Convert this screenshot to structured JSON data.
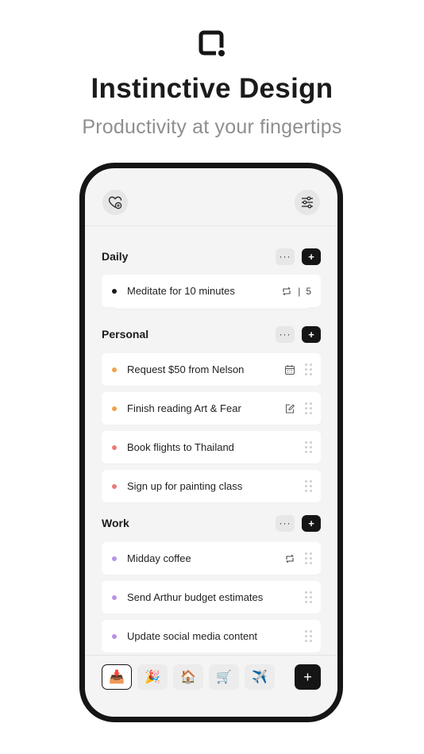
{
  "promo": {
    "title": "Instinctive Design",
    "subtitle": "Productivity at your fingertips"
  },
  "topbar": {
    "left_icon": "heart-plus-icon",
    "right_icon": "sliders-icon"
  },
  "sections": [
    {
      "title": "Daily",
      "more_label": "···",
      "add_label": "+",
      "tasks": [
        {
          "text": "Meditate for 10 minutes",
          "dot_color": "#1a1a1a",
          "icon": "repeat-icon",
          "separator": "|",
          "count": "5"
        }
      ]
    },
    {
      "title": "Personal",
      "more_label": "···",
      "add_label": "+",
      "tasks": [
        {
          "text": "Request $50 from Nelson",
          "dot_color": "#f0a24a",
          "icon": "calendar-icon"
        },
        {
          "text": "Finish reading Art & Fear",
          "dot_color": "#f0a24a",
          "icon": "note-edit-icon"
        },
        {
          "text": "Book flights to Thailand",
          "dot_color": "#ee7a7a",
          "icon": ""
        },
        {
          "text": "Sign up for painting class",
          "dot_color": "#ee7a7a",
          "icon": ""
        }
      ]
    },
    {
      "title": "Work",
      "more_label": "···",
      "add_label": "+",
      "tasks": [
        {
          "text": "Midday coffee",
          "dot_color": "#b892e6",
          "icon": "repeat-icon"
        },
        {
          "text": "Send Arthur budget estimates",
          "dot_color": "#b892e6",
          "icon": ""
        },
        {
          "text": "Update social media content",
          "dot_color": "#b892e6",
          "icon": ""
        }
      ]
    }
  ],
  "bottom_bar": {
    "categories": [
      {
        "emoji": "📥",
        "icon": "inbox-tray-icon",
        "active": true
      },
      {
        "emoji": "🎉",
        "icon": "party-popper-icon",
        "active": false
      },
      {
        "emoji": "🏠",
        "icon": "house-icon",
        "active": false
      },
      {
        "emoji": "🛒",
        "icon": "shopping-cart-icon",
        "active": false
      },
      {
        "emoji": "✈️",
        "icon": "airplane-icon",
        "active": false
      }
    ],
    "new_label": "+"
  },
  "colors": {
    "accent": "#151515",
    "background": "#f4f4f4",
    "card": "#ffffff"
  }
}
